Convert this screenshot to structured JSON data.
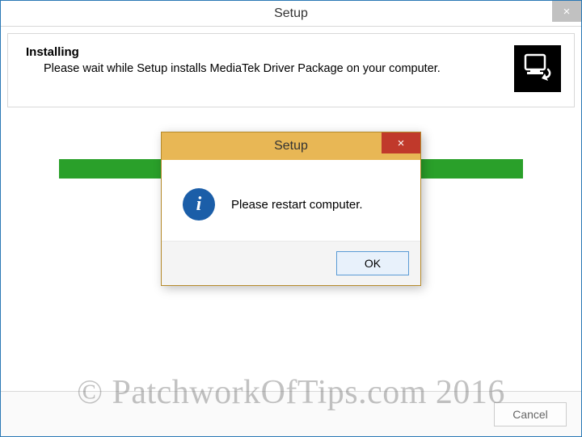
{
  "window": {
    "title": "Setup",
    "close_glyph": "×"
  },
  "header": {
    "title": "Installing",
    "subtitle": "Please wait while Setup installs MediaTek Driver Package on your computer."
  },
  "dialog": {
    "title": "Setup",
    "close_glyph": "×",
    "info_glyph": "i",
    "message": "Please restart computer.",
    "ok_label": "OK"
  },
  "footer": {
    "cancel_label": "Cancel"
  },
  "watermark": {
    "text": "© PatchworkOfTips.com 2016"
  },
  "colors": {
    "accent_border": "#2b79b5",
    "progress": "#2aa02a",
    "dialog_title_bg": "#e8b755",
    "dialog_close_bg": "#c0392b",
    "info_bg": "#1b5ea8",
    "ok_bg": "#e8f1fb",
    "ok_border": "#5a9bd5"
  }
}
